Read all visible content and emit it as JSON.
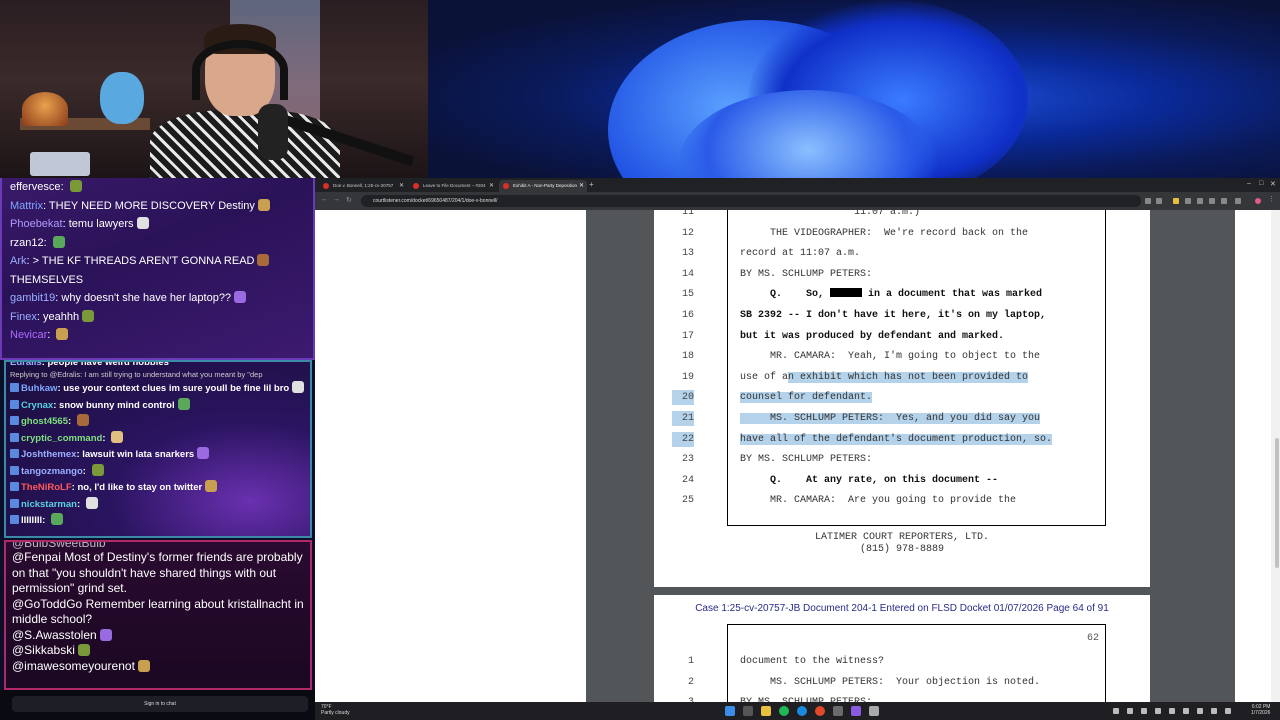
{
  "chat_top": [
    {
      "user": "effervesce",
      "color": "#ffffff",
      "text": ""
    },
    {
      "user": "Mattrix",
      "color": "#7fa8ff",
      "text": "THEY NEED MORE DISCOVERY Destiny"
    },
    {
      "user": "Phoebekat",
      "color": "#b09aff",
      "text": "temu lawyers"
    },
    {
      "user": "rzan12",
      "color": "#ffffff",
      "text": ""
    },
    {
      "user": "Ark",
      "color": "#9ab0ff",
      "text": "> THE KF THREADS AREN'T GONNA READ"
    },
    {
      "user": "",
      "color": "#ffffff",
      "text": "THEMSELVES"
    },
    {
      "user": "gambit19",
      "color": "#9ab0ff",
      "text": "why doesn't she have her laptop??"
    },
    {
      "user": "Finex",
      "color": "#9ab0ff",
      "text": "yeahhh"
    },
    {
      "user": "Nevicar",
      "color": "#b06aff",
      "text": ""
    }
  ],
  "chat_mid": {
    "partial_top": "people have weird hobbies",
    "partial_user": "Edralis",
    "reply_text": "Replying to @Edralis: I am still trying to understand what you meant by \"dep",
    "lines": [
      {
        "user": "Buhkaw",
        "color": "#7fa8ff",
        "text": "use your context clues im sure youll be fine lil bro"
      },
      {
        "user": "Crynax",
        "color": "#5ad0e0",
        "text": "snow bunny mind control"
      },
      {
        "user": "ghost4565",
        "color": "#7fe07f",
        "text": ""
      },
      {
        "user": "cryptic_command",
        "color": "#7fe07f",
        "text": ""
      },
      {
        "user": "Joshthemex",
        "color": "#9ab0ff",
        "text": "lawsuit win lata snarkers"
      },
      {
        "user": "tangozmango",
        "color": "#9ab0ff",
        "text": ""
      },
      {
        "user": "TheNiRoLF",
        "color": "#ff5a5a",
        "text": "no, I'd like to stay on twitter"
      },
      {
        "user": "nickstarman",
        "color": "#5ad0e0",
        "text": ""
      },
      {
        "user": "IIIIIIIl",
        "color": "#ffffff",
        "text": ""
      }
    ]
  },
  "chat_bot": {
    "partial_top": "@BulbSweetBulb",
    "lines": [
      {
        "user": "@Fenpai",
        "text": "Most of Destiny's former friends are probably on that \"you shouldn't have shared things with out permission\" grind set."
      },
      {
        "user": "@GoToddGo",
        "text": "Remember learning about kristallnacht in middle school?"
      },
      {
        "user": "@S.Awasstolen",
        "text": ""
      },
      {
        "user": "@Sikkabski",
        "text": ""
      },
      {
        "user": "@imawesomeyourenot",
        "text": ""
      }
    ],
    "signin_label": "Sign in to chat"
  },
  "browser": {
    "tabs": [
      {
        "label": "Doe v. Bonnell, 1:25-cv-20757"
      },
      {
        "label": "Leave to File Document – #204"
      },
      {
        "label": "Exhibit A - Non-Party Deposition"
      }
    ],
    "url": "courtlistener.com/docket/69650487/204/1/doe-v-bonnell/"
  },
  "doc": {
    "page1_lines": [
      {
        "num": "11",
        "text": "                   11:07 a.m.)",
        "bold": false,
        "hl": false
      },
      {
        "num": "12",
        "text": "     THE VIDEOGRAPHER:  We're record back on the",
        "bold": false,
        "hl": false
      },
      {
        "num": "13",
        "text": "record at 11:07 a.m.",
        "bold": false,
        "hl": false
      },
      {
        "num": "14",
        "text": "BY MS. SCHLUMP PETERS:",
        "bold": false,
        "hl": false
      },
      {
        "num": "15",
        "text_a": "     Q.    So, ",
        "text_b": " in a document that was marked",
        "bold": true,
        "hl": false,
        "redact": true
      },
      {
        "num": "16",
        "text": "SB 2392 -- I don't have it here, it's on my laptop,",
        "bold": true,
        "hl": false
      },
      {
        "num": "17",
        "text": "but it was produced by defendant and marked.",
        "bold": true,
        "hl": false
      },
      {
        "num": "18",
        "text": "     MR. CAMARA:  Yeah, I'm going to object to the",
        "bold": false,
        "hl": false
      },
      {
        "num": "19",
        "text_a": "use of a",
        "text_b": "n exhibit which has not been provided to",
        "bold": false,
        "hl": "partial"
      },
      {
        "num": "20",
        "text": "counsel for defendant.",
        "bold": false,
        "hl": true
      },
      {
        "num": "21",
        "text": "     MS. SCHLUMP PETERS:  Yes, and you did say you",
        "bold": false,
        "hl": true
      },
      {
        "num": "22",
        "text": "have all of the defendant's document production, so.",
        "bold": false,
        "hl": true
      },
      {
        "num": "23",
        "text": "BY MS. SCHLUMP PETERS:",
        "bold": false,
        "hl": false
      },
      {
        "num": "24",
        "text": "     Q.    At any rate, on this document --",
        "bold": true,
        "hl": false
      },
      {
        "num": "25",
        "text": "     MR. CAMARA:  Are you going to provide the",
        "bold": false,
        "hl": false
      }
    ],
    "reporter_name": "LATIMER COURT REPORTERS, LTD.",
    "reporter_phone": "(815) 978-8889",
    "case_header": "Case 1:25-cv-20757-JB   Document 204-1   Entered on FLSD Docket 01/07/2026   Page 64 of 91",
    "page_number": "62",
    "page2_lines": [
      {
        "num": "1",
        "text": "document to the witness?"
      },
      {
        "num": "2",
        "text": "     MS. SCHLUMP PETERS:  Your objection is noted."
      },
      {
        "num": "3",
        "text": "BY MS. SCHLUMP PETERS:"
      }
    ]
  },
  "taskbar": {
    "temp": "70°F",
    "weather": "Partly cloudy",
    "time": "6:02 PM",
    "date": "1/7/2026"
  }
}
